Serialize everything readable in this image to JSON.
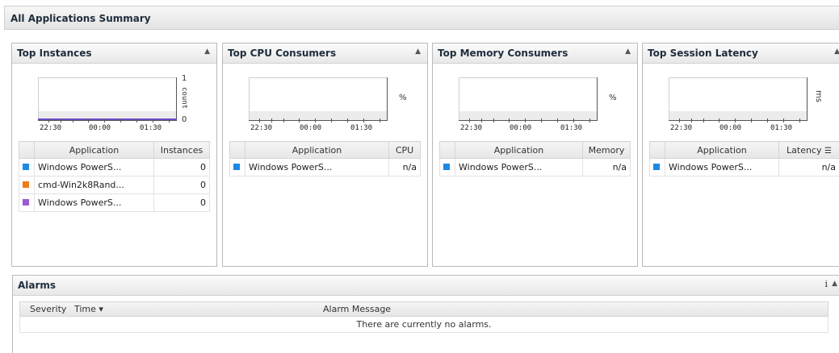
{
  "summary": {
    "title": "All Applications Summary"
  },
  "panels": [
    {
      "title": "Top Instances",
      "collapse_icon": "▲",
      "chart": {
        "ticks": [
          "22:30",
          "00:00",
          "01:30"
        ],
        "y_top": "1",
        "y_bottom": "0",
        "unit": "count"
      },
      "columns": [
        "Application",
        "Instances"
      ],
      "rows": [
        {
          "app": "Windows PowerS...",
          "value": "0",
          "color": "#1e88e5"
        },
        {
          "app": "cmd-Win2k8Rand...",
          "value": "0",
          "color": "#ef7d16"
        },
        {
          "app": "Windows PowerS...",
          "value": "0",
          "color": "#9b59d6"
        }
      ]
    },
    {
      "title": "Top CPU Consumers",
      "collapse_icon": "▲",
      "chart": {
        "ticks": [
          "22:30",
          "00:00",
          "01:30"
        ],
        "unit": "%"
      },
      "columns": [
        "Application",
        "CPU"
      ],
      "rows": [
        {
          "app": "Windows PowerS...",
          "value": "n/a",
          "color": "#1e88e5"
        }
      ]
    },
    {
      "title": "Top Memory Consumers",
      "collapse_icon": "▲",
      "chart": {
        "ticks": [
          "22:30",
          "00:00",
          "01:30"
        ],
        "unit": "%"
      },
      "columns": [
        "Application",
        "Memory"
      ],
      "rows": [
        {
          "app": "Windows PowerS...",
          "value": "n/a",
          "color": "#1e88e5"
        }
      ]
    },
    {
      "title": "Top Session Latency",
      "collapse_icon": "▲",
      "chart": {
        "ticks": [
          "22:30",
          "00:00",
          "01:30"
        ],
        "unit": "ms"
      },
      "columns": [
        "Application",
        "Latency"
      ],
      "rows": [
        {
          "app": "Windows PowerS...",
          "value": "n/a",
          "color": "#1e88e5"
        }
      ]
    }
  ],
  "alarms": {
    "title": "Alarms",
    "info_icon": "i",
    "columns": {
      "severity": "Severity",
      "time": "Time ▾",
      "message": "Alarm Message"
    },
    "empty_message": "There are currently no alarms."
  }
}
